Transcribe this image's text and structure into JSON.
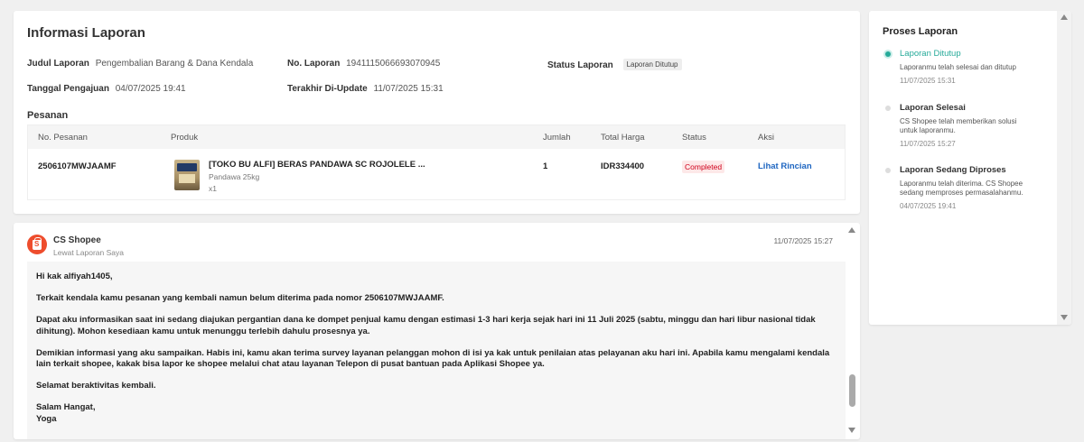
{
  "info": {
    "title": "Informasi Laporan",
    "judul_label": "Judul Laporan",
    "judul_value": "Pengembalian Barang & Dana Kendala",
    "no_label": "No. Laporan",
    "no_value": "1941115066693070945",
    "status_label": "Status Laporan",
    "status_value": "Laporan Ditutup",
    "tanggal_label": "Tanggal Pengajuan",
    "tanggal_value": "04/07/2025 19:41",
    "update_label": "Terakhir Di-Update",
    "update_value": "11/07/2025 15:31"
  },
  "orders": {
    "title": "Pesanan",
    "headers": {
      "order_no": "No. Pesanan",
      "product": "Produk",
      "qty": "Jumlah",
      "total": "Total Harga",
      "status": "Status",
      "action": "Aksi"
    },
    "row": {
      "order_no": "2506107MWJAAMF",
      "product_name": "[TOKO BU ALFI] BERAS PANDAWA SC ROJOLELE ...",
      "variation": "Pandawa 25kg",
      "product_qty": "x1",
      "qty": "1",
      "total": "IDR334400",
      "status": "Completed",
      "action": "Lihat Rincian"
    }
  },
  "message": {
    "sender": "CS Shopee",
    "via": "Lewat Laporan Saya",
    "time": "11/07/2025 15:27",
    "paragraphs": [
      "Hi kak alfiyah1405,",
      "Terkait kendala kamu pesanan yang kembali namun belum diterima pada nomor 2506107MWJAAMF.",
      "Dapat aku informasikan saat ini sedang diajukan pergantian dana ke dompet penjual kamu dengan estimasi 1-3 hari kerja sejak hari ini 11 Juli 2025 (sabtu, minggu dan hari libur nasional tidak dihitung). Mohon kesediaan kamu untuk menunggu terlebih dahulu prosesnya ya.",
      "Demikian informasi yang aku sampaikan. Habis ini, kamu akan terima survey layanan pelanggan mohon di isi ya kak untuk penilaian atas pelayanan aku hari ini. Apabila kamu mengalami kendala lain terkait shopee, kakak bisa lapor ke shopee melalui chat atau layanan Telepon di pusat bantuan pada Aplikasi Shopee ya.",
      "Selamat beraktivitas kembali.",
      "Salam Hangat,\nYoga"
    ]
  },
  "process": {
    "title": "Proses Laporan",
    "steps": [
      {
        "label": "Laporan Ditutup",
        "desc": "Laporanmu telah selesai dan ditutup",
        "time": "11/07/2025 15:31"
      },
      {
        "label": "Laporan Selesai",
        "desc": "CS Shopee telah memberikan solusi untuk laporanmu.",
        "time": "11/07/2025 15:27"
      },
      {
        "label": "Laporan Sedang Diproses",
        "desc": "Laporanmu telah diterima. CS Shopee sedang memproses permasalahanmu.",
        "time": "04/07/2025 19:41"
      }
    ]
  },
  "colors": {
    "accent_teal": "#26aa99",
    "status_red": "#d0011b",
    "link_blue": "#1e66c1",
    "shopee_orange": "#ee4d2d"
  },
  "icons": {
    "avatar": "shopee-bag-icon",
    "scroll_up": "scroll-up-arrow-icon",
    "scroll_down": "scroll-down-arrow-icon"
  }
}
